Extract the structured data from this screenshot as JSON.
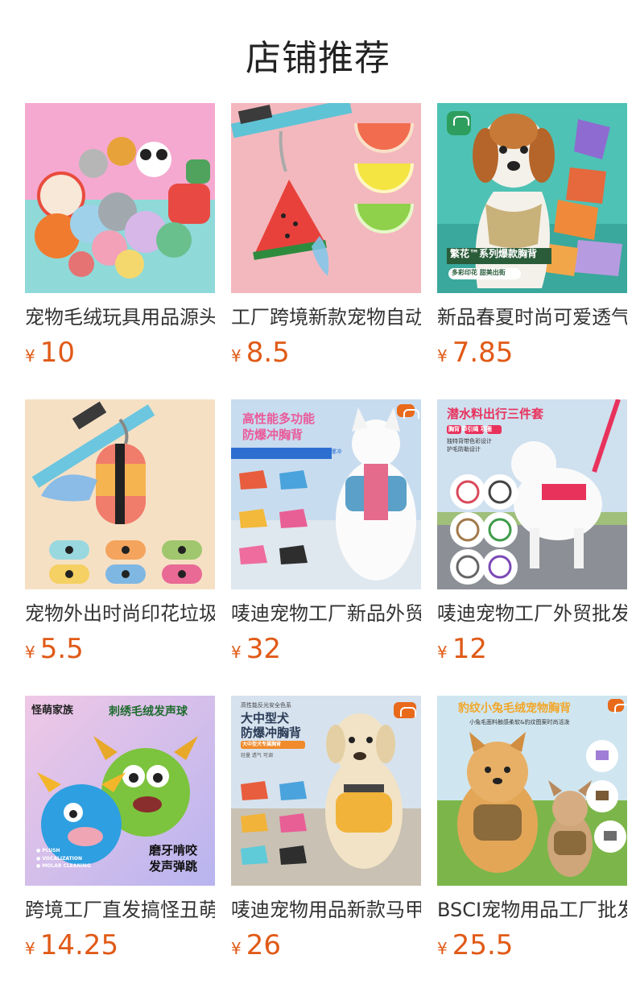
{
  "page": {
    "title": "店铺推荐"
  },
  "currency": "¥",
  "products": [
    {
      "title": "宠物毛绒玩具用品源头工厂",
      "price": "10"
    },
    {
      "title": "工厂跨境新款宠物自动垃圾袋",
      "price": "8.5"
    },
    {
      "title": "新品春夏时尚可爱透气胸背",
      "price": "7.85"
    },
    {
      "title": "宠物外出时尚印花垃圾袋",
      "price": "5.5"
    },
    {
      "title": "唛迪宠物工厂新品外贸胸背",
      "price": "32"
    },
    {
      "title": "唛迪宠物工厂外贸批发胸背",
      "price": "12"
    },
    {
      "title": "跨境工厂直发搞怪丑萌玩具",
      "price": "14.25"
    },
    {
      "title": "唛迪宠物用品新款马甲胸背",
      "price": "26"
    },
    {
      "title": "BSCI宠物用品工厂批发胸背",
      "price": "25.5"
    }
  ],
  "image_text": {
    "p3_banner": "繁花™系列爆款胸背",
    "p3_sub": "多彩印花  甜美出街",
    "p5_title1": "高性能多功能",
    "p5_title2": "防爆冲胸背",
    "p5_tags": "多功能一体化 自带小包 透气舒适防爆冲",
    "p6_title": "潜水料出行三件套",
    "p6_tags": "胸背  牵引绳  项圈",
    "p6_sub1": "独特背带色彩设计",
    "p6_sub2": "护毛防勒设计",
    "p7_brand": "怪萌家族",
    "p7_title": "刺绣毛绒发声球",
    "p7_features": "● PLUSH\n● VOCALIZATION\n● MOLAR CLEANING",
    "p7_bottom1": "磨牙啃咬",
    "p7_bottom2": "发声弹跳",
    "p8_top": "高性能反光安全色系",
    "p8_title1": "大中型犬",
    "p8_title2": "防爆冲胸背",
    "p8_tag": "大中型犬专属胸背",
    "p8_small": "轻量  透气  可调",
    "p9_title": "豹纹小兔毛绒宠物胸背",
    "p9_sub": "小兔毛面料触感柔软&豹纹图案时尚活泼"
  },
  "colors": {
    "price": "#e05a17",
    "title": "#333333",
    "brand_badge": "#e86a1a"
  }
}
